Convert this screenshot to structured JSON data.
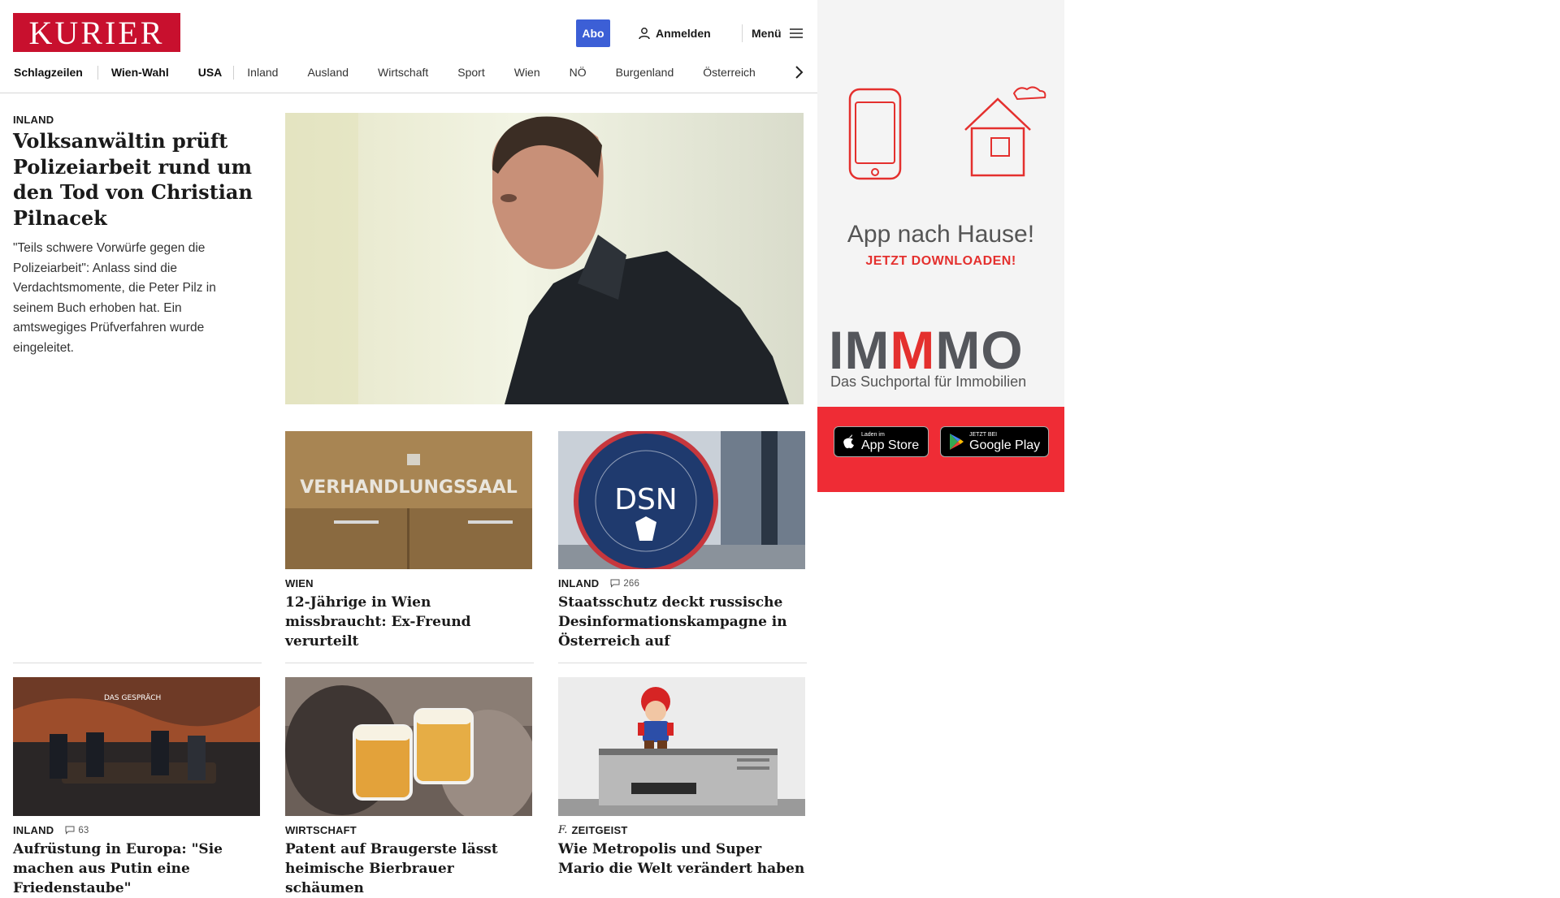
{
  "header": {
    "logo": "KURIER",
    "abo_label": "Abo",
    "login_label": "Anmelden",
    "menu_label": "Menü"
  },
  "nav": {
    "items": [
      "Schlagzeilen",
      "Wien-Wahl",
      "USA",
      "Inland",
      "Ausland",
      "Wirtschaft",
      "Sport",
      "Wien",
      "NÖ",
      "Burgenland",
      "Österreich"
    ]
  },
  "lead": {
    "kicker": "INLAND",
    "headline": "Volksanwältin prüft Polizeiarbeit rund um den Tod von Christian Pilnacek",
    "teaser": "\"Teils schwere Vorwürfe gegen die Polizeiarbeit\": Anlass sind die Verdachtsmomente, die Peter Pilz in seinem Buch erhoben hat. Ein amtswegiges Prüfverfahren wurde eingeleitet."
  },
  "articles": [
    {
      "kicker": "WIEN",
      "headline": "12-Jährige in Wien missbraucht: Ex-Freund verurteilt",
      "image_text": "VERHANDLUNGSSAAL"
    },
    {
      "kicker": "INLAND",
      "comments": "266",
      "headline": "Staatsschutz deckt russische Desinformationskampagne in Österreich auf",
      "image_text": "DSN"
    },
    {
      "kicker": "INLAND",
      "comments": "63",
      "headline": "Aufrüstung in Europa: \"Sie machen aus Putin eine Friedenstaube\"",
      "image_text": "DAS GESPRÄCH"
    },
    {
      "kicker": "WIRTSCHAFT",
      "headline": "Patent auf Braugerste lässt heimische Bierbrauer schäumen"
    },
    {
      "kicker": "ZEITGEIST",
      "headline": "Wie Metropolis und Super Mario die Welt verändert haben"
    }
  ],
  "ad": {
    "title": "App nach Hause!",
    "subtitle": "JETZT DOWNLOADEN!",
    "brand": "IMMMO",
    "brand_sub": "Das Suchportal für Immobilien",
    "appstore_small": "Laden im",
    "appstore_big": "App Store",
    "googleplay_small": "JETZT BEI",
    "googleplay_big": "Google Play"
  },
  "colors": {
    "brand_red": "#c8102e",
    "abo_blue": "#3c5fd6",
    "ad_red": "#ef2c35"
  }
}
